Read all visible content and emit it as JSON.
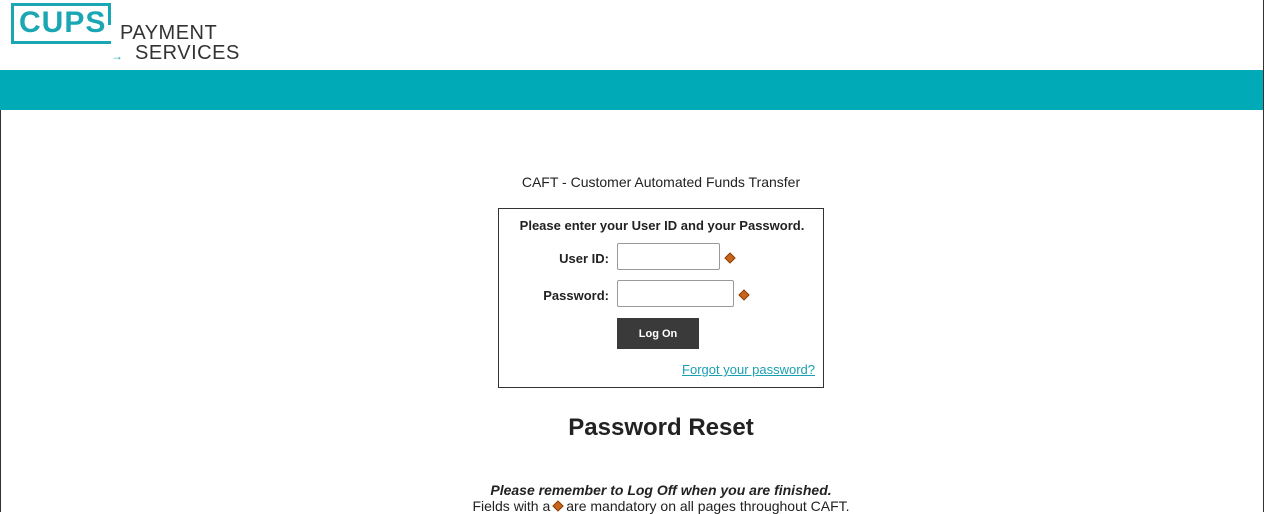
{
  "brand": {
    "logo_primary": "CUPS",
    "logo_line1": "PAYMENT",
    "logo_line2": "SERVICES",
    "accent_color": "#00abb7"
  },
  "page": {
    "app_title": "CAFT - Customer Automated Funds Transfer",
    "section_title": "Password Reset"
  },
  "login": {
    "heading": "Please enter your User ID and your Password.",
    "user_id_label": "User ID:",
    "user_id_value": "",
    "password_label": "Password:",
    "password_value": "",
    "logon_button": "Log On",
    "forgot_link": "Forgot your password?",
    "required_icon": "orange-diamond-icon"
  },
  "footer": {
    "remember_text": "Please remember to Log Off when you are finished.",
    "mandatory_prefix": "Fields with a",
    "mandatory_suffix": "are mandatory on all pages throughout CAFT."
  }
}
